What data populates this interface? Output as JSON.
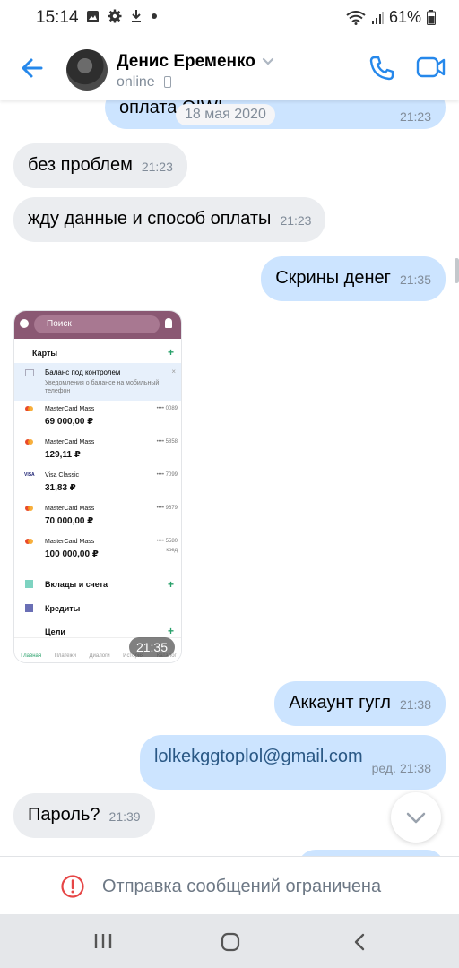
{
  "status_bar": {
    "time": "15:14",
    "battery": "61%"
  },
  "header": {
    "name": "Денис Еременко",
    "status": "online"
  },
  "chat": {
    "date_badge": "18 мая 2020",
    "partial_message": {
      "text": "оплата QIWI",
      "time": "21:23"
    },
    "messages": [
      {
        "dir": "in",
        "text": "без проблем",
        "time": "21:23"
      },
      {
        "dir": "in",
        "text": "жду данные и способ оплаты",
        "time": "21:23"
      },
      {
        "dir": "out",
        "text": "Скрины денег",
        "time": "21:35"
      },
      {
        "dir": "out",
        "text": "Аккаунт гугл",
        "time": "21:38"
      },
      {
        "dir": "out",
        "text": "lolkekggtoplol@gmail.com",
        "edited": "ред.",
        "time": "21:38"
      },
      {
        "dir": "in",
        "text": "Пароль?",
        "time": "21:39"
      }
    ],
    "image": {
      "time": "21:35",
      "search": "Поиск",
      "cards_title": "Карты",
      "notice_title": "Баланс под контролем",
      "notice_text": "Уведомления о балансе на мобильный телефон",
      "cards": [
        {
          "name": "MasterCard Mass",
          "amount": "69 000,00 ₽",
          "num": "•••• 0089"
        },
        {
          "name": "MasterCard Mass",
          "amount": "129,11 ₽",
          "num": "•••• 5858"
        },
        {
          "name": "Visa Classic",
          "amount": "31,83 ₽",
          "num": "•••• 7099"
        },
        {
          "name": "MasterCard Mass",
          "amount": "70 000,00 ₽",
          "num": "•••• 9679"
        },
        {
          "name": "MasterCard Mass",
          "amount": "100 000,00 ₽",
          "num": "•••• 5580"
        }
      ],
      "credit_label": "кред",
      "deposits": "Вклады и счета",
      "credits": "Кредиты",
      "goals": "Цели",
      "tabs": [
        "Главная",
        "Платежи",
        "Диалоги",
        "История",
        "Каталог"
      ]
    }
  },
  "footer": {
    "restriction": "Отправка сообщений ограничена"
  },
  "colors": {
    "accent": "#2688eb",
    "incoming": "#ebedf0",
    "outgoing": "#cce4ff",
    "warning": "#e64646"
  }
}
